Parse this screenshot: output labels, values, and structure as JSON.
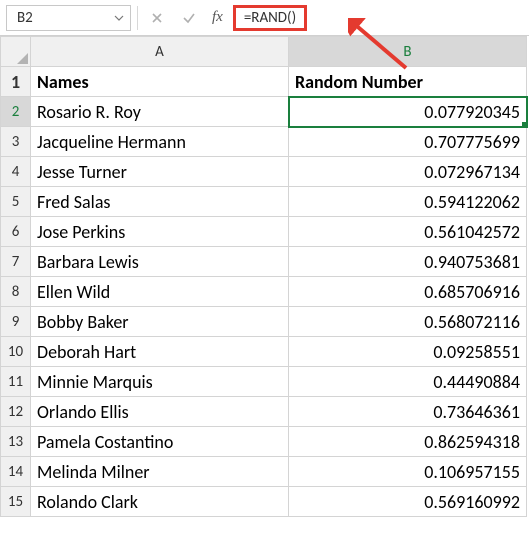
{
  "formula_bar": {
    "name_box": "B2",
    "formula": "=RAND()"
  },
  "columns": {
    "corner": "",
    "a": "A",
    "b": "B"
  },
  "headers": {
    "names": "Names",
    "random": "Random Number"
  },
  "rows": [
    {
      "n": "1"
    },
    {
      "n": "2",
      "name": "Rosario R. Roy",
      "rand": "0.077920345"
    },
    {
      "n": "3",
      "name": "Jacqueline Hermann",
      "rand": "0.707775699"
    },
    {
      "n": "4",
      "name": "Jesse Turner",
      "rand": "0.072967134"
    },
    {
      "n": "5",
      "name": "Fred Salas",
      "rand": "0.594122062"
    },
    {
      "n": "6",
      "name": "Jose Perkins",
      "rand": "0.561042572"
    },
    {
      "n": "7",
      "name": "Barbara Lewis",
      "rand": "0.940753681"
    },
    {
      "n": "8",
      "name": "Ellen Wild",
      "rand": "0.685706916"
    },
    {
      "n": "9",
      "name": "Bobby Baker",
      "rand": "0.568072116"
    },
    {
      "n": "10",
      "name": "Deborah Hart",
      "rand": "0.09258551"
    },
    {
      "n": "11",
      "name": "Minnie Marquis",
      "rand": "0.44490884"
    },
    {
      "n": "12",
      "name": "Orlando Ellis",
      "rand": "0.73646361"
    },
    {
      "n": "13",
      "name": "Pamela Costantino",
      "rand": "0.862594318"
    },
    {
      "n": "14",
      "name": "Melinda Milner",
      "rand": "0.106957155"
    },
    {
      "n": "15",
      "name": "Rolando Clark",
      "rand": "0.569160992"
    }
  ],
  "selected": {
    "row": "2",
    "col": "B"
  }
}
